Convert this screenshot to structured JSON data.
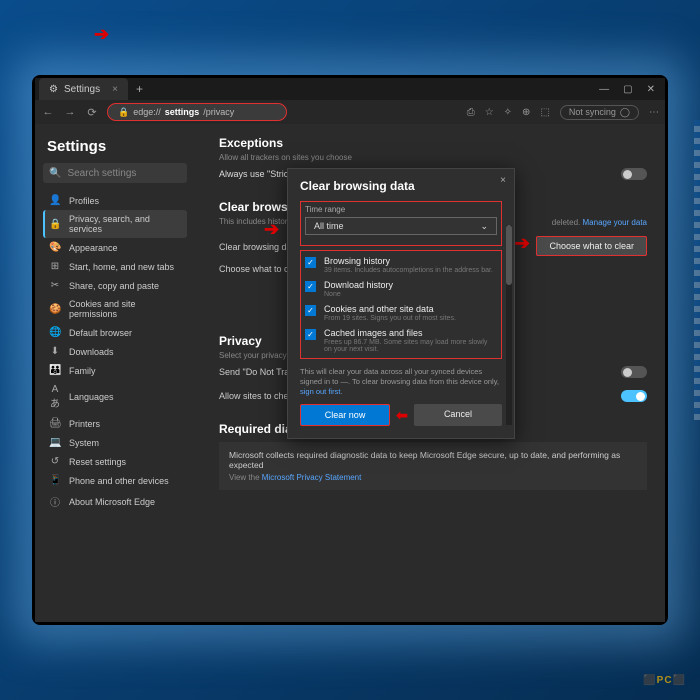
{
  "tab": {
    "icon": "⚙",
    "title": "Settings"
  },
  "url": {
    "prefix": "edge://",
    "bold": "settings",
    "suffix": "/privacy"
  },
  "profile_status": "Not syncing",
  "sidebar": {
    "title": "Settings",
    "search_placeholder": "Search settings",
    "items": [
      {
        "icon": "👤",
        "label": "Profiles"
      },
      {
        "icon": "🔒",
        "label": "Privacy, search, and services"
      },
      {
        "icon": "🎨",
        "label": "Appearance"
      },
      {
        "icon": "⊞",
        "label": "Start, home, and new tabs"
      },
      {
        "icon": "✂",
        "label": "Share, copy and paste"
      },
      {
        "icon": "🍪",
        "label": "Cookies and site permissions"
      },
      {
        "icon": "🌐",
        "label": "Default browser"
      },
      {
        "icon": "⬇",
        "label": "Downloads"
      },
      {
        "icon": "👪",
        "label": "Family"
      },
      {
        "icon": "Aあ",
        "label": "Languages"
      },
      {
        "icon": "🖨",
        "label": "Printers"
      },
      {
        "icon": "💻",
        "label": "System"
      },
      {
        "icon": "↺",
        "label": "Reset settings"
      },
      {
        "icon": "📱",
        "label": "Phone and other devices"
      },
      {
        "icon": "ⓘ",
        "label": "About Microsoft Edge"
      }
    ]
  },
  "content": {
    "exceptions_title": "Exceptions",
    "exceptions_sub": "Allow all trackers on sites you choose",
    "strict_label": "Always use \"Strict\" tracking prevention when browsing InPrivate",
    "clear_section_title": "Clear browsing",
    "clear_sub": "This includes history, p",
    "clear_sub_end": "deleted.",
    "manage_link": "Manage your data",
    "clear_row1": "Clear browsing data",
    "clear_row2": "Choose what to cle",
    "choose_btn": "Choose what to clear",
    "privacy_title": "Privacy",
    "privacy_sub": "Select your privacy set",
    "dnt_label": "Send \"Do Not Trac",
    "allow_label": "Allow sites to check",
    "diag_title": "Required diagnostic data",
    "diag_text": "Microsoft collects required diagnostic data to keep Microsoft Edge secure, up to date, and performing as expected",
    "diag_link_pre": "View the ",
    "diag_link": "Microsoft Privacy Statement"
  },
  "modal": {
    "title": "Clear browsing data",
    "range_label": "Time range",
    "range_value": "All time",
    "items": [
      {
        "label": "Browsing history",
        "sub": "39 items. Includes autocompletions in the address bar."
      },
      {
        "label": "Download history",
        "sub": "None"
      },
      {
        "label": "Cookies and other site data",
        "sub": "From 19 sites. Signs you out of most sites."
      },
      {
        "label": "Cached images and files",
        "sub": "Frees up 86.7 MB. Some sites may load more slowly on your next visit."
      }
    ],
    "info_pre": "This will clear your data across all your synced devices signed in to ",
    "info_mid": ". To clear browsing data from this device only, ",
    "info_link": "sign out first",
    "primary": "Clear now",
    "secondary": "Cancel"
  }
}
